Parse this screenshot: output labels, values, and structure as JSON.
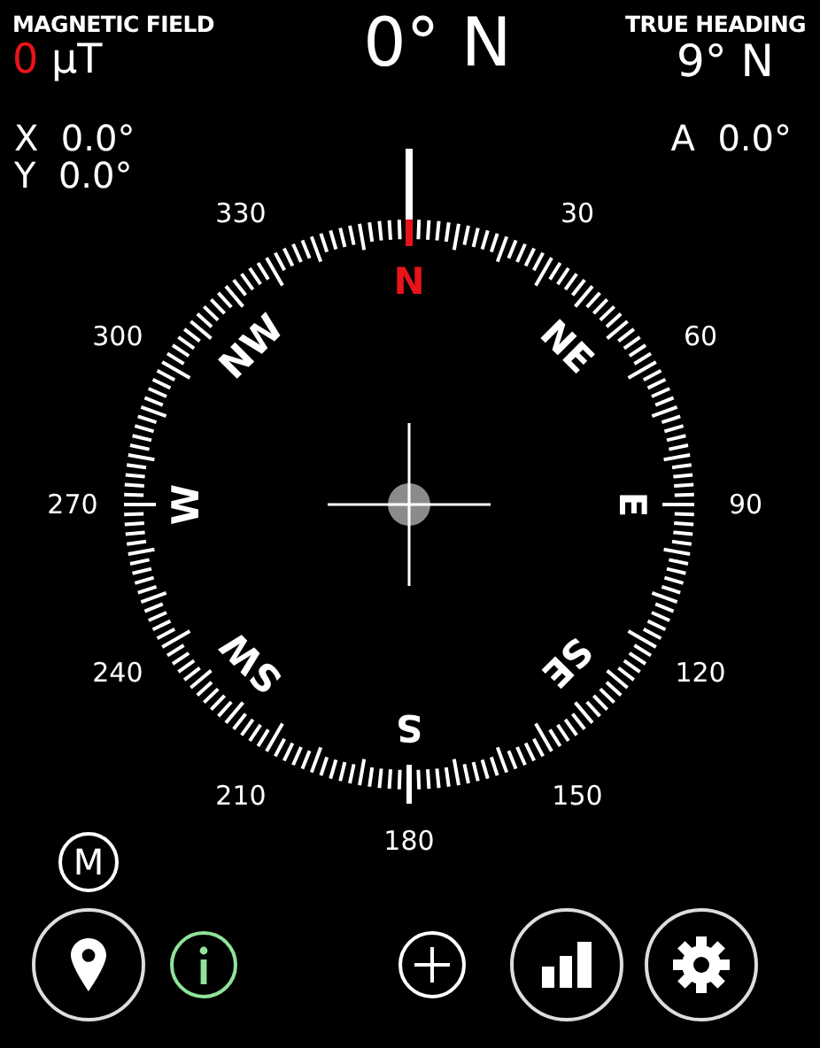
{
  "magnetic_field": {
    "label": "MAGNETIC FIELD",
    "value": "0",
    "unit": "µT"
  },
  "heading": "0° N",
  "true_heading": {
    "label": "TRUE HEADING",
    "value": "9° N"
  },
  "tilt": [
    {
      "axis": "X",
      "value": "0.0°"
    },
    {
      "axis": "Y",
      "value": "0.0°"
    }
  ],
  "accuracy": {
    "axis": "A",
    "value": "0.0°"
  },
  "dial": {
    "cardinals": [
      {
        "label": "N",
        "color": "#e8141b"
      },
      {
        "label": "NE",
        "color": "#ffffff"
      },
      {
        "label": "E",
        "color": "#ffffff"
      },
      {
        "label": "SE",
        "color": "#ffffff"
      },
      {
        "label": "S",
        "color": "#ffffff"
      },
      {
        "label": "SW",
        "color": "#ffffff"
      },
      {
        "label": "W",
        "color": "#ffffff"
      },
      {
        "label": "NW",
        "color": "#ffffff"
      }
    ],
    "degree_labels": [
      "30",
      "60",
      "90",
      "120",
      "150",
      "180",
      "210",
      "240",
      "270",
      "300",
      "330"
    ]
  },
  "mode_button": {
    "label": "M"
  },
  "toolbar": [
    {
      "kind": "location"
    },
    {
      "kind": "info"
    },
    {
      "kind": "add"
    },
    {
      "kind": "chart"
    },
    {
      "kind": "settings"
    }
  ]
}
